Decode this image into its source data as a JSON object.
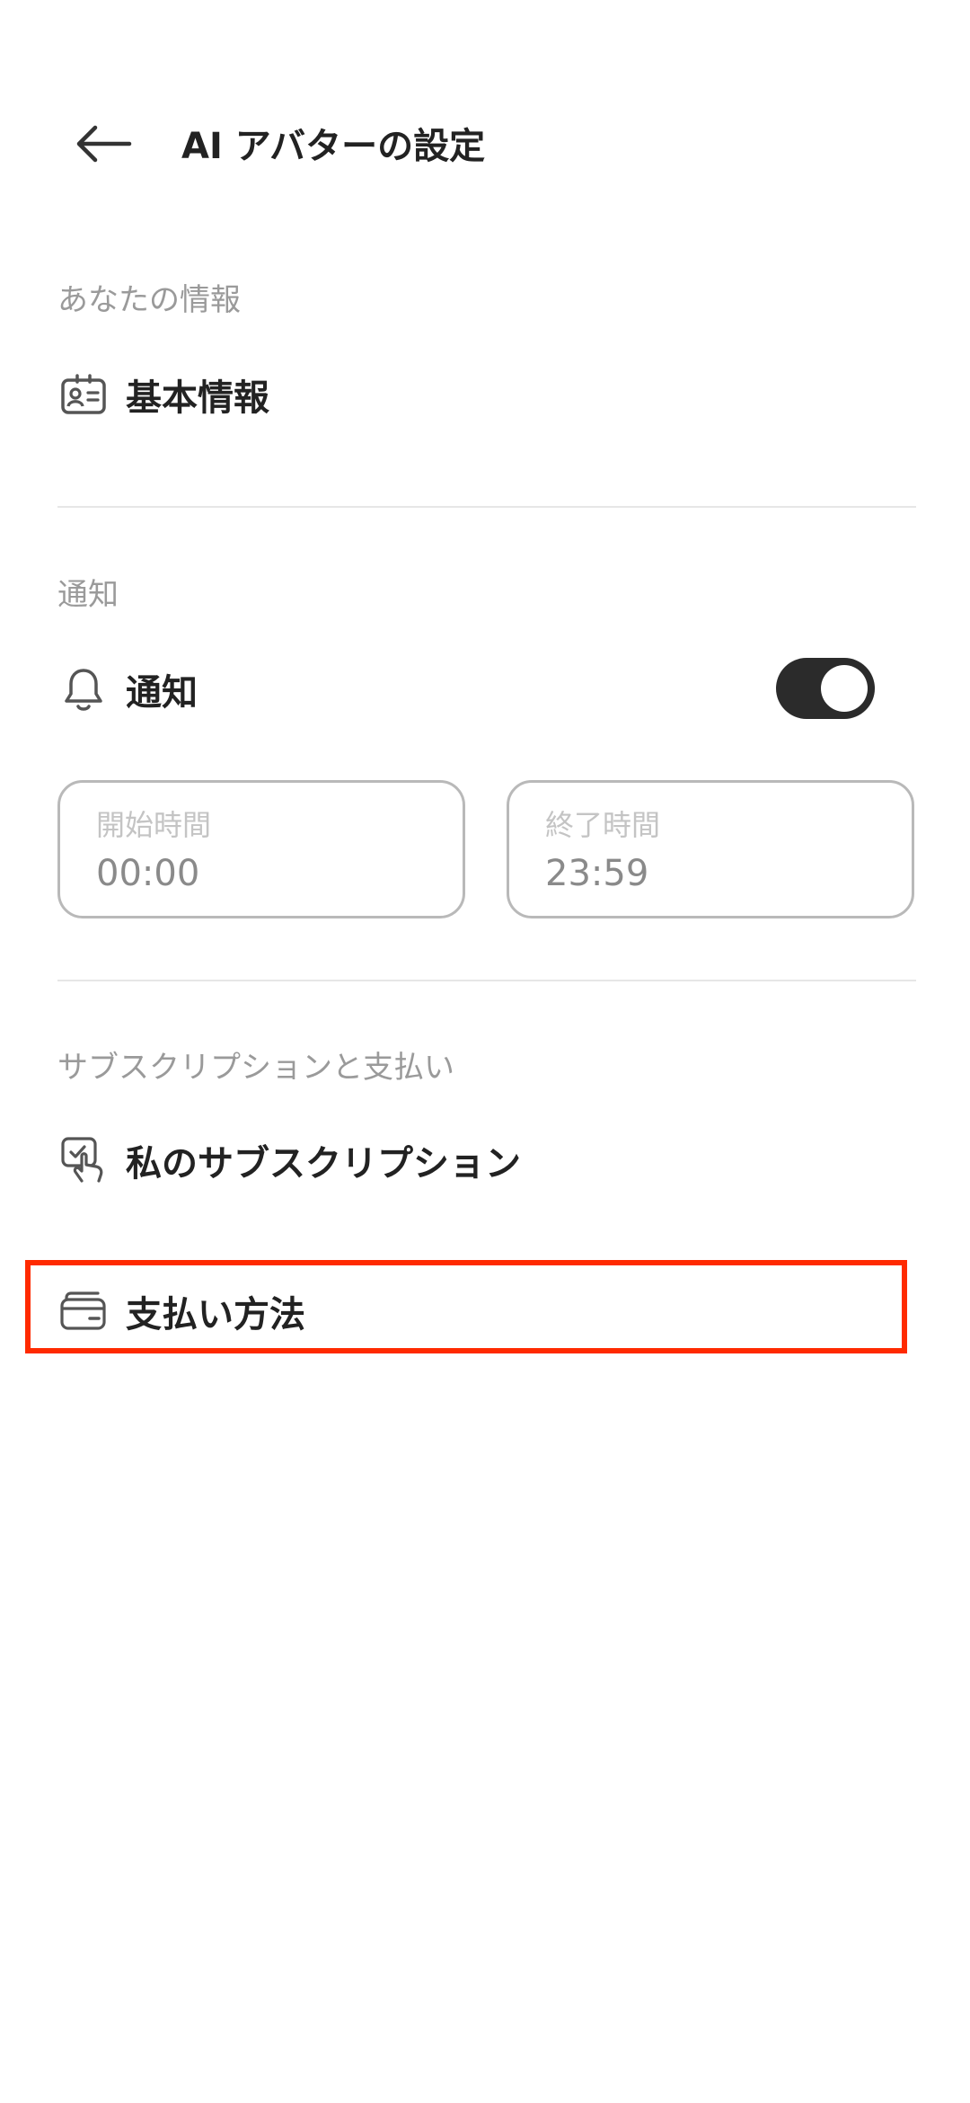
{
  "header": {
    "title": "AI アバターの設定",
    "back_icon": "arrow-left-icon"
  },
  "sections": {
    "info": {
      "label": "あなたの情報",
      "items": [
        {
          "label": "基本情報",
          "icon": "id-card-icon"
        }
      ]
    },
    "notifications": {
      "label": "通知",
      "toggle_row": {
        "label": "通知",
        "icon": "bell-icon",
        "enabled": true
      },
      "start_time": {
        "caption": "開始時間",
        "value": "00:00"
      },
      "end_time": {
        "caption": "終了時間",
        "value": "23:59"
      }
    },
    "subscription": {
      "label": "サブスクリプションと支払い",
      "items": [
        {
          "label": "私のサブスクリプション",
          "icon": "tap-hand-icon"
        },
        {
          "label": "支払い方法",
          "icon": "wallet-card-icon",
          "highlighted": true
        }
      ]
    }
  },
  "colors": {
    "highlight": "#ff2a00",
    "toggle_on": "#2b2b2b",
    "section_label": "#9a9a9a"
  }
}
